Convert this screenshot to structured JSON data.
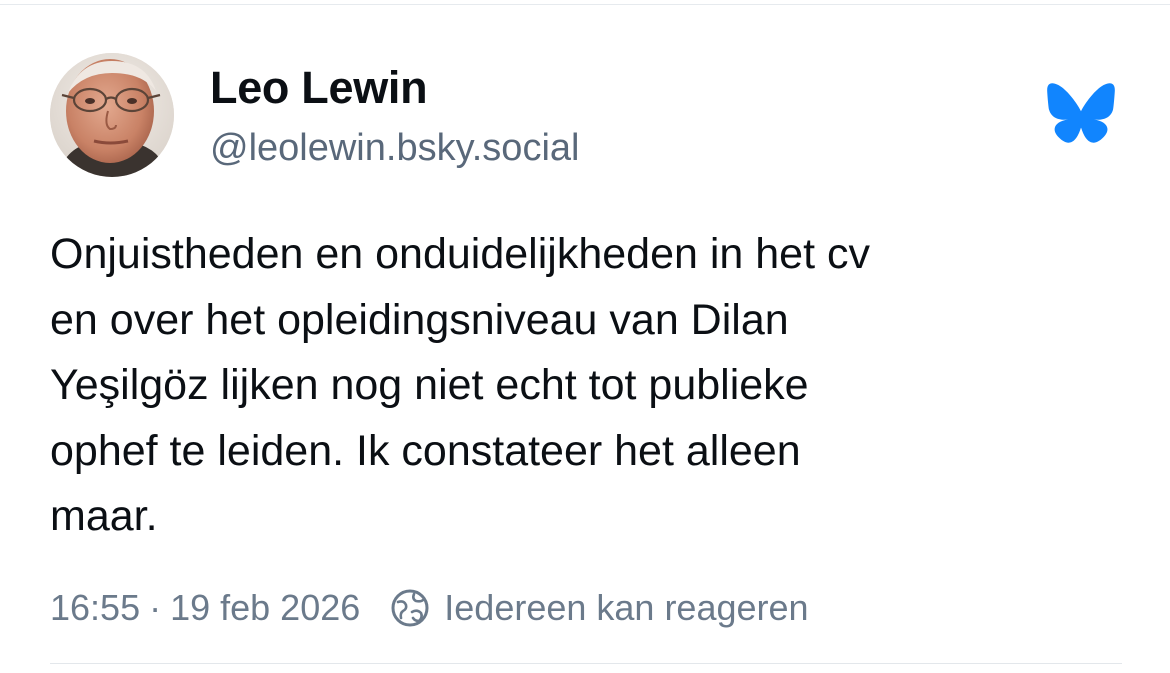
{
  "post": {
    "author": {
      "display_name": "Leo Lewin",
      "handle": "@leolewin.bsky.social",
      "avatar": "profile-photo"
    },
    "text": "Onjuistheden en onduidelijkheden in het cv\nen over het opleidingsniveau van Dilan\nYeşilgöz lijken nog niet echt tot publieke\nophef te leiden. Ik constateer het alleen\nmaar.",
    "time": "16:55",
    "separator": "·",
    "date": "19 feb 2026",
    "reply_setting_icon": "globe-reply-icon",
    "reply_setting": "Iedereen kan reageren"
  },
  "brand": {
    "icon": "bluesky-butterfly-icon",
    "color": "#1185fe"
  },
  "colors": {
    "text": "#0b0f14",
    "secondary": "#6b7a8b"
  }
}
